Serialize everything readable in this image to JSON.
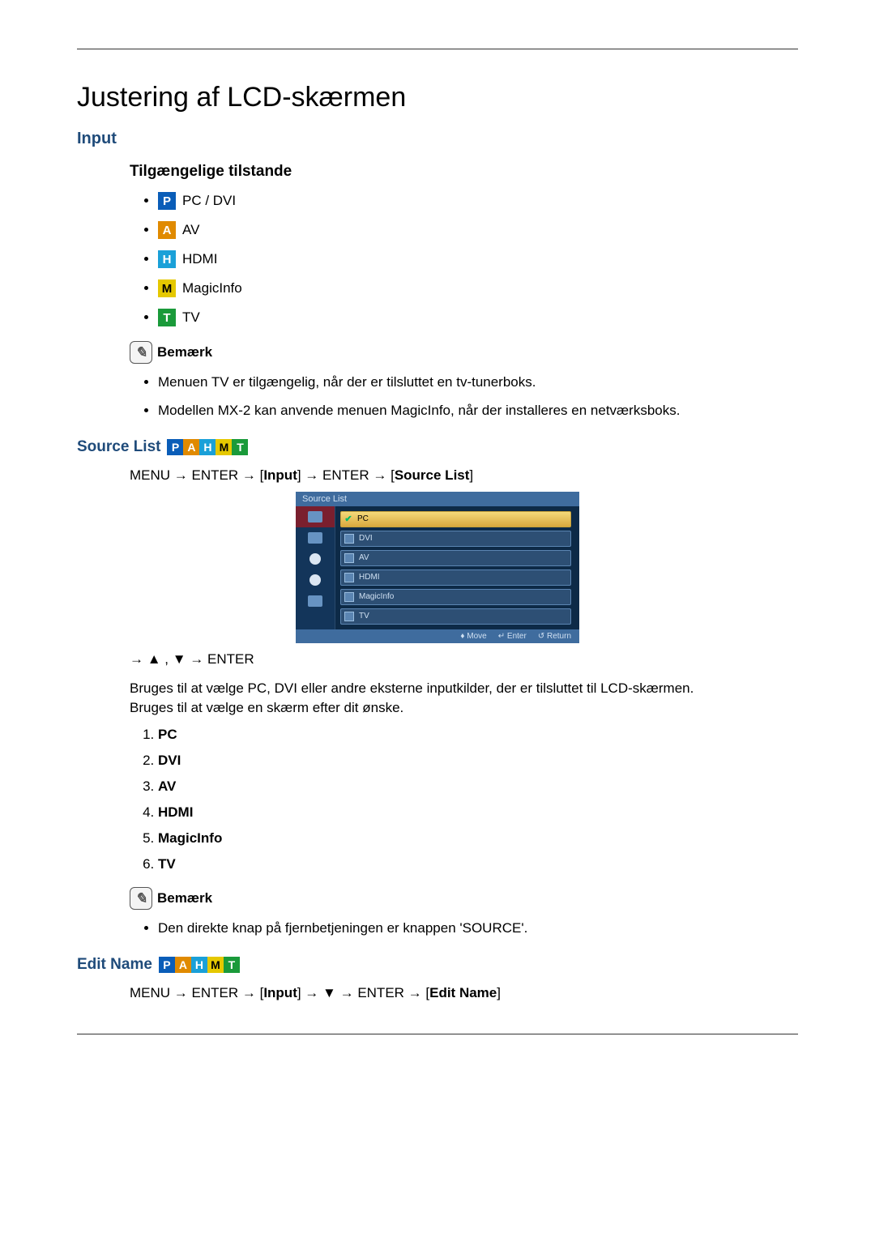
{
  "title": "Justering af LCD-skærmen",
  "input": {
    "heading": "Input",
    "modes_heading": "Tilgængelige tilstande",
    "modes": [
      {
        "badge": "P",
        "cls": "badge-p",
        "label": "PC / DVI"
      },
      {
        "badge": "A",
        "cls": "badge-a",
        "label": "AV"
      },
      {
        "badge": "H",
        "cls": "badge-h",
        "label": "HDMI"
      },
      {
        "badge": "M",
        "cls": "badge-m",
        "label": "MagicInfo"
      },
      {
        "badge": "T",
        "cls": "badge-t",
        "label": "TV"
      }
    ],
    "note_label": "Bemærk",
    "note_bullets": [
      "Menuen TV er tilgængelig, når der er tilsluttet en tv-tunerboks.",
      "Modellen MX-2 kan anvende menuen MagicInfo, når der installeres en netværksboks."
    ]
  },
  "source_list": {
    "heading": "Source List",
    "path": {
      "menu": "MENU",
      "enter": "ENTER",
      "input_lbl": "Input",
      "source_lbl": "Source List"
    },
    "screenshot": {
      "title": "Source List",
      "rows": [
        "PC",
        "DVI",
        "AV",
        "HDMI",
        "MagicInfo",
        "TV"
      ],
      "foot_move": "Move",
      "foot_enter": "Enter",
      "foot_return": "Return"
    },
    "nav_line": "→ ▲ , ▼ → ENTER",
    "desc1": "Bruges til at vælge PC, DVI eller andre eksterne inputkilder, der er tilsluttet til LCD-skærmen.",
    "desc2": "Bruges til at vælge en skærm efter dit ønske.",
    "items": [
      "PC",
      "DVI",
      "AV",
      "HDMI",
      "MagicInfo",
      "TV"
    ],
    "note_label": "Bemærk",
    "note_bullet": "Den direkte knap på fjernbetjeningen er knappen 'SOURCE'."
  },
  "edit_name": {
    "heading": "Edit Name",
    "path": {
      "menu": "MENU",
      "enter": "ENTER",
      "input_lbl": "Input",
      "down": "▼",
      "edit_lbl": "Edit Name"
    }
  }
}
